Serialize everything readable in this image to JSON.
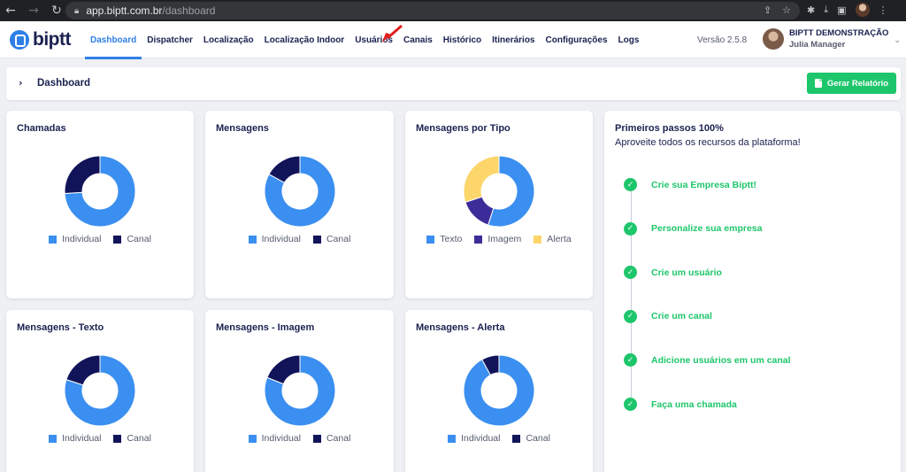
{
  "browser": {
    "url_host": "app.biptt.com.br",
    "url_path": "/dashboard"
  },
  "app": {
    "logo_text": "biptt",
    "version": "Versão 2.5.8",
    "user_company": "BIPTT DEMONSTRAÇÃO",
    "user_name": "Julia Manager"
  },
  "nav": [
    {
      "label": "Dashboard",
      "active": true
    },
    {
      "label": "Dispatcher"
    },
    {
      "label": "Localização"
    },
    {
      "label": "Localização Indoor"
    },
    {
      "label": "Usuários"
    },
    {
      "label": "Canais"
    },
    {
      "label": "Histórico"
    },
    {
      "label": "Itinerários"
    },
    {
      "label": "Configurações"
    },
    {
      "label": "Logs"
    }
  ],
  "breadcrumb": {
    "title": "Dashboard",
    "report_button": "Gerar Relatório"
  },
  "colors": {
    "individual": "#3a8ff0",
    "canal": "#12145a",
    "texto": "#3a8ff0",
    "imagem": "#3b2d99",
    "alerta": "#fcd66a",
    "accent": "#2e7fe6",
    "success": "#1ec66b"
  },
  "cards": [
    {
      "title": "Chamadas",
      "legend": [
        "Individual",
        "Canal"
      ],
      "slices": [
        0.74,
        0.26
      ]
    },
    {
      "title": "Mensagens",
      "legend": [
        "Individual",
        "Canal"
      ],
      "slices": [
        0.83,
        0.17
      ]
    },
    {
      "title": "Mensagens por Tipo",
      "legend": [
        "Texto",
        "Imagem",
        "Alerta"
      ],
      "slices": [
        0.55,
        0.15,
        0.3
      ]
    },
    {
      "title": "Mensagens - Texto",
      "legend": [
        "Individual",
        "Canal"
      ],
      "slices": [
        0.8,
        0.2
      ]
    },
    {
      "title": "Mensagens - Imagem",
      "legend": [
        "Individual",
        "Canal"
      ],
      "slices": [
        0.81,
        0.19
      ]
    },
    {
      "title": "Mensagens - Alerta",
      "legend": [
        "Individual",
        "Canal"
      ],
      "slices": [
        0.92,
        0.08
      ]
    }
  ],
  "steps": {
    "title": "Primeiros passos 100%",
    "subtitle": "Aproveite todos os recursos da plataforma!",
    "progress_percent": 100,
    "items": [
      "Crie sua Empresa Biptt!",
      "Personalize sua empresa",
      "Crie um usuário",
      "Crie um canal",
      "Adicione usuários em um canal",
      "Faça uma chamada"
    ]
  }
}
